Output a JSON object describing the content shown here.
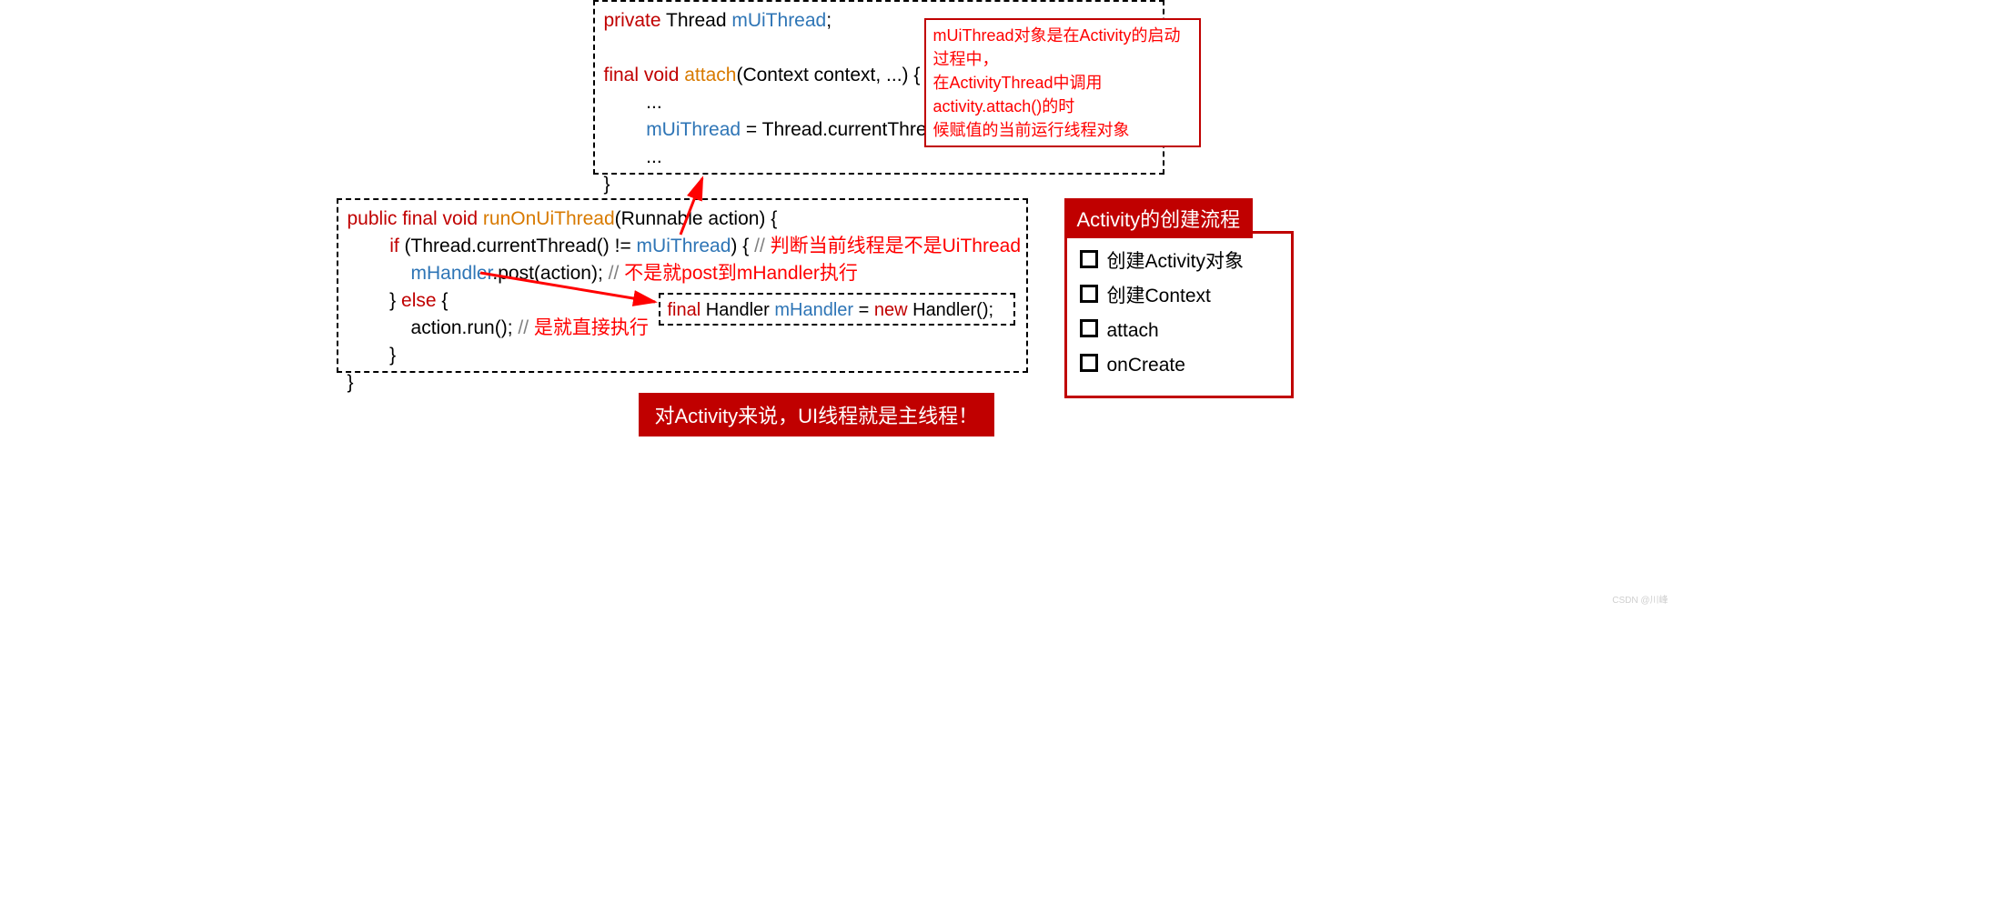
{
  "topBox": {
    "line1_private": "private",
    "line1_thread": " Thread ",
    "line1_member": "mUiThread",
    "line1_end": ";",
    "line2_final": "final",
    "line2_void": " void ",
    "line2_method": "attach",
    "line2_sig": "(Context context, ...) {",
    "line3": "        ...",
    "line4_indent": "        ",
    "line4_member": "mUiThread",
    "line4_rest": " = Thread.currentThread();",
    "line5": "        ...",
    "line6": "}"
  },
  "note1": {
    "l1": "mUiThread对象是在Activity的启动过程中，",
    "l2": "在ActivityThread中调用activity.attach()的时",
    "l3": "候赋值的当前运行线程对象"
  },
  "mainBox": {
    "l1_kw": "public final void ",
    "l1_method": "runOnUiThread",
    "l1_sig": "(Runnable action) {",
    "l2_indent": "        ",
    "l2_if": "if",
    "l2_cond_pre": " (Thread.currentThread() != ",
    "l2_member": "mUiThread",
    "l2_cond_post": ") { ",
    "l2_comment_prefix": "// ",
    "l2_comment_text": "判断当前线程是不是UiThread",
    "l3_indent": "            ",
    "l3_member": "mHandler",
    "l3_rest": ".post(action); ",
    "l3_comment_prefix": "// ",
    "l3_comment_text": "不是就post到mHandler执行",
    "l4_indent": "        } ",
    "l4_else": "else",
    "l4_brace": " {",
    "l5_indent": "            action.run(); ",
    "l5_comment_prefix": "// ",
    "l5_comment_text": "是就直接执行",
    "l6": "        }",
    "l7": "}"
  },
  "handlerBox": {
    "kw_final": "final",
    "mid1": " Handler ",
    "member": "mHandler",
    "eq": " = ",
    "kw_new": "new",
    "mid2": " Handler();"
  },
  "flow": {
    "title": "Activity的创建流程",
    "items": [
      "创建Activity对象",
      "创建Context",
      "attach",
      "onCreate"
    ]
  },
  "banner": "对Activity来说，UI线程就是主线程！",
  "watermark": "CSDN @川峰"
}
